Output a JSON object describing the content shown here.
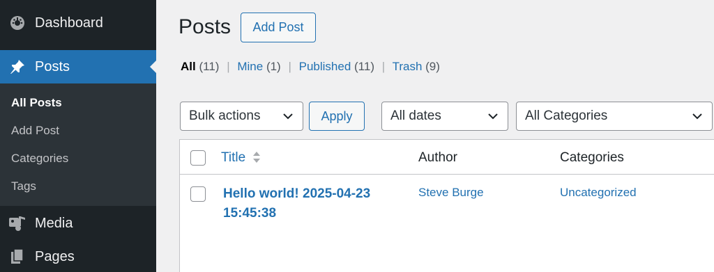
{
  "sidebar": {
    "dashboard": {
      "label": "Dashboard",
      "icon": "dashboard-gauge-icon"
    },
    "posts": {
      "label": "Posts",
      "icon": "pushpin-icon"
    },
    "submenu": [
      {
        "label": "All Posts",
        "current": true
      },
      {
        "label": "Add Post",
        "current": false
      },
      {
        "label": "Categories",
        "current": false
      },
      {
        "label": "Tags",
        "current": false
      }
    ],
    "media": {
      "label": "Media",
      "icon": "media-icon"
    },
    "pages": {
      "label": "Pages",
      "icon": "pages-icon"
    }
  },
  "header": {
    "title": "Posts",
    "add_post_label": "Add Post"
  },
  "filters": {
    "all": {
      "label": "All",
      "count": "(11)"
    },
    "mine": {
      "label": "Mine",
      "count": "(1)"
    },
    "published": {
      "label": "Published",
      "count": "(11)"
    },
    "trash": {
      "label": "Trash",
      "count": "(9)"
    },
    "separator": "|"
  },
  "toolbar": {
    "bulk_actions": "Bulk actions",
    "apply_label": "Apply",
    "dates": "All dates",
    "categories": "All Categories"
  },
  "table": {
    "columns": {
      "title": "Title",
      "author": "Author",
      "categories": "Categories"
    },
    "rows": [
      {
        "title_line1": "Hello world! 2025-04-23",
        "title_line2": "15:45:38",
        "author": "Steve Burge",
        "categories": "Uncategorized"
      }
    ]
  },
  "colors": {
    "sidebar_bg": "#1d2327",
    "accent": "#2271b1",
    "page_bg": "#f0f0f1"
  }
}
